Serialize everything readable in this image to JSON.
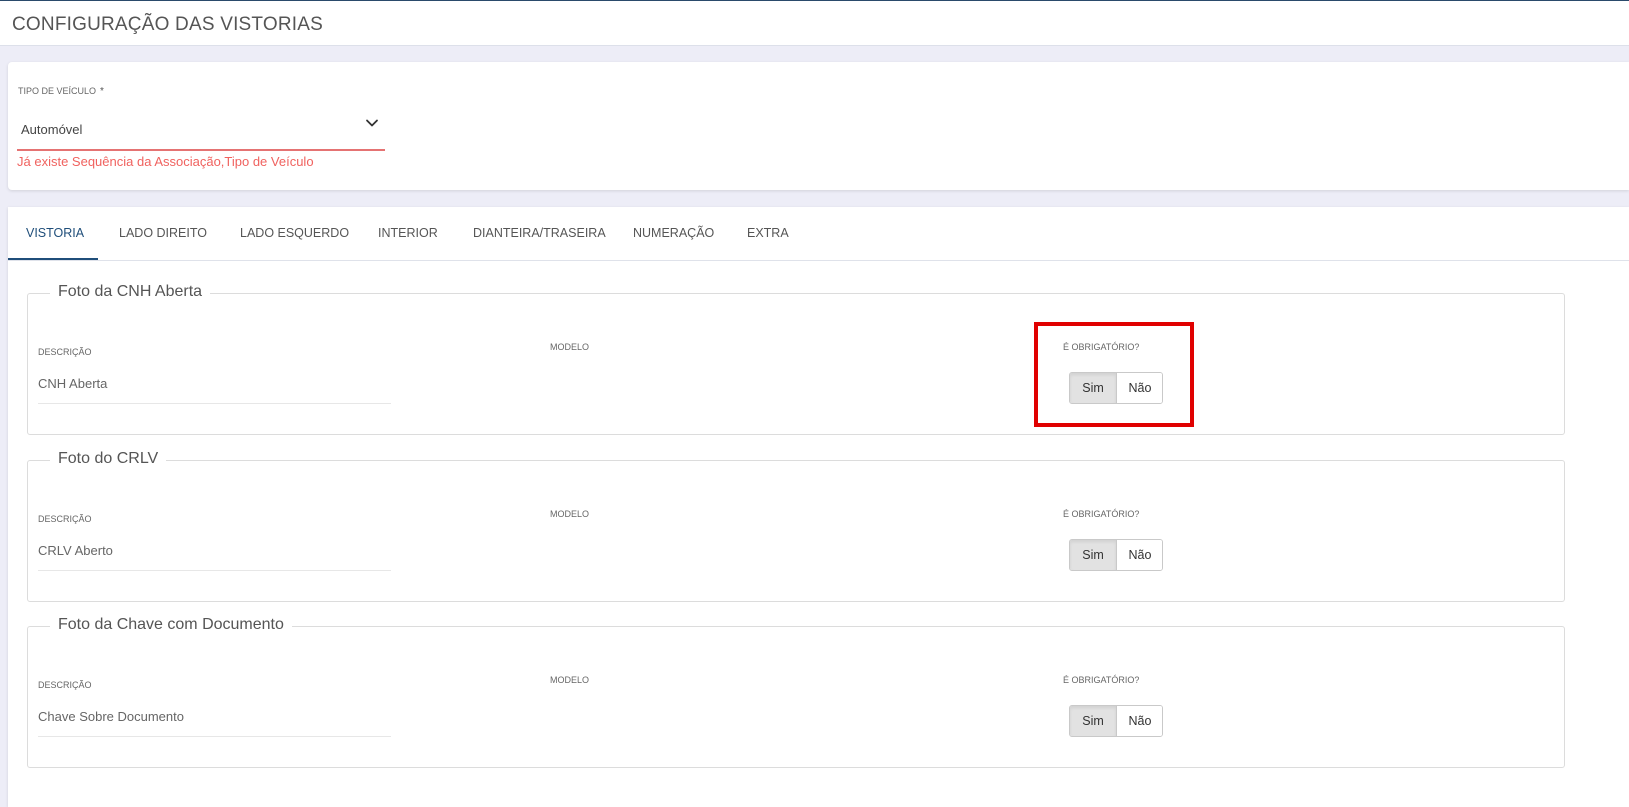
{
  "page": {
    "title": "CONFIGURAÇÃO DAS VISTORIAS"
  },
  "vehicle_type": {
    "label": "TIPO DE VEÍCULO",
    "required_mark": "*",
    "value": "Automóvel",
    "error": "Já existe Sequência da Associação,Tipo de Veículo"
  },
  "tabs": [
    {
      "label": "VISTORIA",
      "active": true
    },
    {
      "label": "LADO DIREITO",
      "active": false
    },
    {
      "label": "LADO ESQUERDO",
      "active": false
    },
    {
      "label": "INTERIOR",
      "active": false
    },
    {
      "label": "DIANTEIRA/TRASEIRA",
      "active": false
    },
    {
      "label": "NUMERAÇÃO",
      "active": false
    },
    {
      "label": "EXTRA",
      "active": false
    }
  ],
  "sections": [
    {
      "title": "Foto da CNH Aberta",
      "description_label": "DESCRIÇÃO",
      "description_value": "CNH Aberta",
      "model_label": "MODELO",
      "required_label": "É OBRIGATÓRIO?",
      "yes_label": "Sim",
      "no_label": "Não",
      "selected": "Sim"
    },
    {
      "title": "Foto do CRLV",
      "description_label": "DESCRIÇÃO",
      "description_value": "CRLV Aberto",
      "model_label": "MODELO",
      "required_label": "É OBRIGATÓRIO?",
      "yes_label": "Sim",
      "no_label": "Não",
      "selected": "Sim"
    },
    {
      "title": "Foto da Chave com Documento",
      "description_label": "DESCRIÇÃO",
      "description_value": "Chave Sobre Documento",
      "model_label": "MODELO",
      "required_label": "É OBRIGATÓRIO?",
      "yes_label": "Sim",
      "no_label": "Não",
      "selected": "Sim"
    }
  ],
  "colors": {
    "active_tab": "#1f4e7a",
    "error": "#f0625f",
    "highlight": "#e00000"
  },
  "icons": {
    "select": "chevron-down-icon"
  }
}
